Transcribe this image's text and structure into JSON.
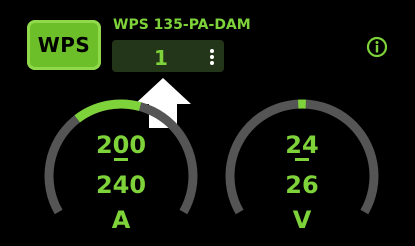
{
  "logo": {
    "text": "WPS"
  },
  "device": {
    "name": "WPS 135-PA-DAM"
  },
  "channel": {
    "value": "1"
  },
  "icons": {
    "info": "info-circle-icon",
    "menu": "kebab-menu-icon",
    "pointer": "up-arrow-icon"
  },
  "gauges": [
    {
      "setpoint": "200",
      "actual": "240",
      "unit": "A",
      "level": 0.22
    },
    {
      "setpoint": "24",
      "actual": "26",
      "unit": "V",
      "level": 0.02
    }
  ],
  "colors": {
    "accent": "#7ed23a",
    "logo_bg": "#6dbf2a",
    "channel_bg": "#24361a",
    "gauge_track": "#555555",
    "background": "#000000"
  }
}
